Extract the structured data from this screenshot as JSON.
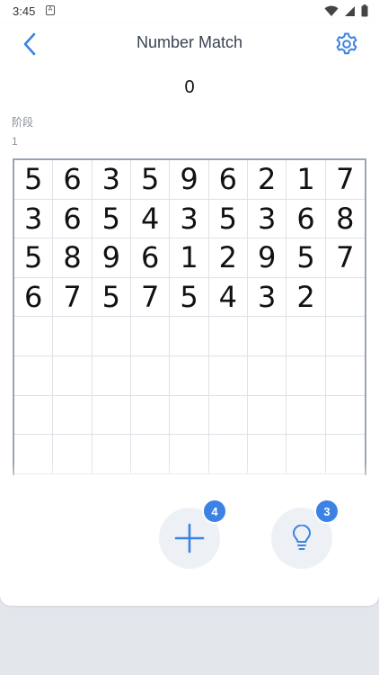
{
  "status_bar": {
    "time": "3:45",
    "notification_glyph": "A",
    "icons": [
      "wifi-icon",
      "signal-icon",
      "battery-icon"
    ]
  },
  "header": {
    "title": "Number Match",
    "back_icon": "chevron-left-icon",
    "settings_icon": "gear-icon"
  },
  "score": "0",
  "stage": {
    "label": "阶段",
    "value": "1"
  },
  "board": {
    "columns": 9,
    "cells": [
      "5",
      "6",
      "3",
      "5",
      "9",
      "6",
      "2",
      "1",
      "7",
      "3",
      "6",
      "5",
      "4",
      "3",
      "5",
      "3",
      "6",
      "8",
      "5",
      "8",
      "9",
      "6",
      "1",
      "2",
      "9",
      "5",
      "7",
      "6",
      "7",
      "5",
      "7",
      "5",
      "4",
      "3",
      "2",
      "",
      "",
      "",
      "",
      "",
      "",
      "",
      "",
      "",
      "",
      "",
      "",
      "",
      "",
      "",
      "",
      "",
      "",
      "",
      "",
      "",
      "",
      "",
      "",
      "",
      "",
      "",
      "",
      "",
      "",
      "",
      "",
      "",
      "",
      "",
      "",
      ""
    ]
  },
  "actions": {
    "add": {
      "icon": "plus-icon",
      "badge": "4"
    },
    "hint": {
      "icon": "lightbulb-icon",
      "badge": "3"
    }
  },
  "colors": {
    "accent": "#3b82e4",
    "title": "#3a4252",
    "grid_line": "#dde2e8",
    "board_border": "#9aa3af",
    "action_bg": "#edf1f5"
  }
}
